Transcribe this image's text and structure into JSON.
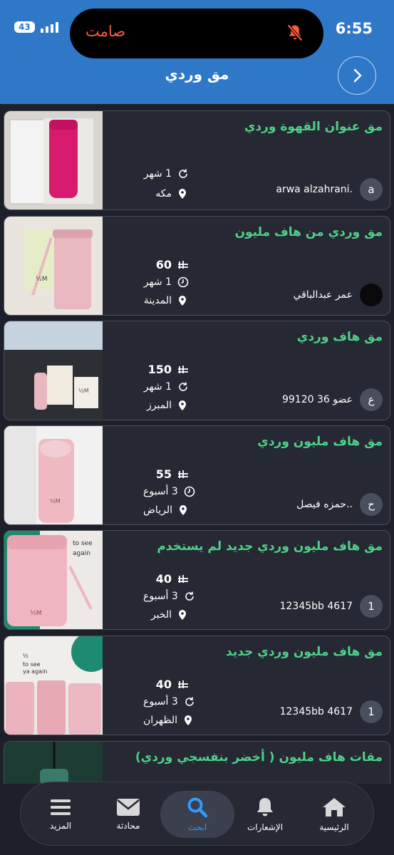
{
  "status_bar": {
    "time": "6:55",
    "battery": "43",
    "dynamic_island_text": "صامت"
  },
  "header": {
    "title": "مق وردي"
  },
  "listings": [
    {
      "title": "مق عنوان القهوة وردي",
      "price": "",
      "time": "1 شهر",
      "time_icon": "refresh-icon",
      "city": "مكه",
      "seller": "arwa alzahrani.",
      "avatar": "a",
      "avatar_style": "letter"
    },
    {
      "title": "مق وردي من هاف مليون",
      "price": "60",
      "time": "1 شهر",
      "time_icon": "clock-icon",
      "city": "المدينة",
      "seller": "عمر عبدالباقي",
      "avatar": "",
      "avatar_style": "black"
    },
    {
      "title": "مق هاف وردي",
      "price": "150",
      "time": "1 شهر",
      "time_icon": "refresh-icon",
      "city": "المبرز",
      "seller": "عضو 36 99120",
      "avatar": "ع",
      "avatar_style": "letter"
    },
    {
      "title": "مق هاف مليون وردي",
      "price": "55",
      "time": "3 أسبوع",
      "time_icon": "clock-icon",
      "city": "الرياض",
      "seller": "حمزه فيصل..",
      "avatar": "ح",
      "avatar_style": "letter"
    },
    {
      "title": "مق هاف مليون وردي جديد لم يستخدم",
      "price": "40",
      "time": "3 أسبوع",
      "time_icon": "refresh-icon",
      "city": "الخبر",
      "seller": "12345bb 4617",
      "avatar": "1",
      "avatar_style": "letter"
    },
    {
      "title": "مق هاف مليون وردي جديد",
      "price": "40",
      "time": "3 أسبوع",
      "time_icon": "refresh-icon",
      "city": "الظهران",
      "seller": "12345bb 4617",
      "avatar": "1",
      "avatar_style": "letter"
    },
    {
      "title": "مقات هاف مليون ( أخضر بنفسجي وردي)",
      "price": "",
      "time": "",
      "time_icon": "",
      "city": "",
      "seller": "",
      "avatar": "",
      "avatar_style": "letter"
    }
  ],
  "bottom_nav": {
    "items": [
      {
        "label": "الرئيسية",
        "icon": "home-icon",
        "active": false
      },
      {
        "label": "الإشعارات",
        "icon": "bell-icon",
        "active": false
      },
      {
        "label": "ابحث",
        "icon": "search-icon",
        "active": true
      },
      {
        "label": "محادثة",
        "icon": "mail-icon",
        "active": false
      },
      {
        "label": "المزيد",
        "icon": "menu-icon",
        "active": false
      }
    ]
  },
  "colors": {
    "header_bg": "#2f78c8",
    "title_green": "#4fd08a",
    "active_blue": "#2f9cff",
    "bg": "#1e2029"
  }
}
